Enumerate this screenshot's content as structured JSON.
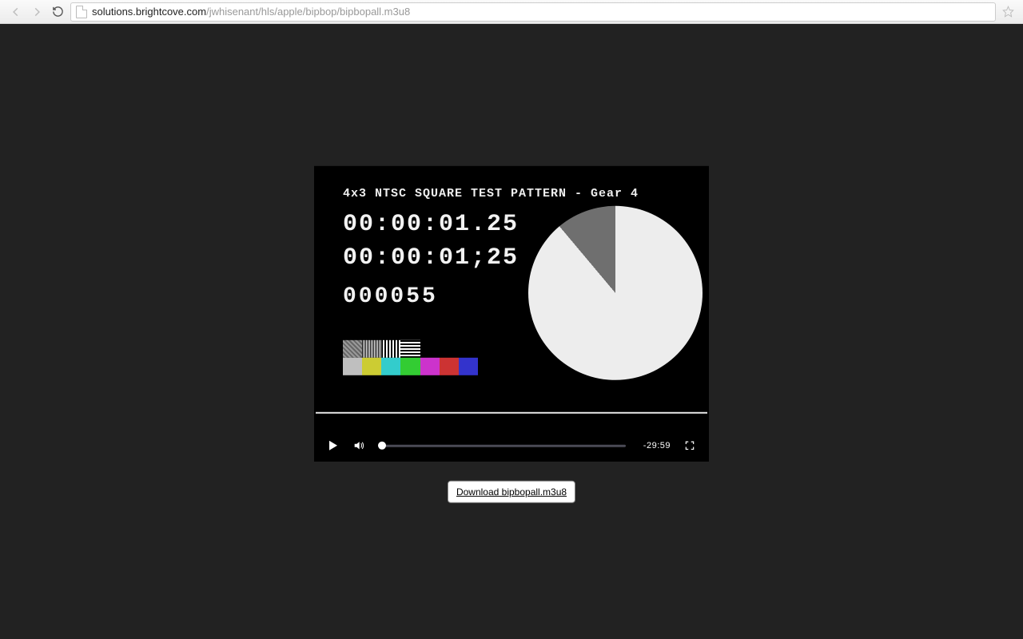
{
  "chrome": {
    "url_host": "solutions.brightcove.com",
    "url_path": "/jwhisenant/hls/apple/bipbop/bipbopall.m3u8"
  },
  "video_overlay": {
    "title": "4x3 NTSC SQUARE TEST PATTERN - Gear 4",
    "time1": "00:00:01.25",
    "time2": "00:00:01;25",
    "counter": "000055"
  },
  "player": {
    "time_remaining": "-29:59"
  },
  "download": {
    "label": "Download bipbopall.m3u8"
  }
}
